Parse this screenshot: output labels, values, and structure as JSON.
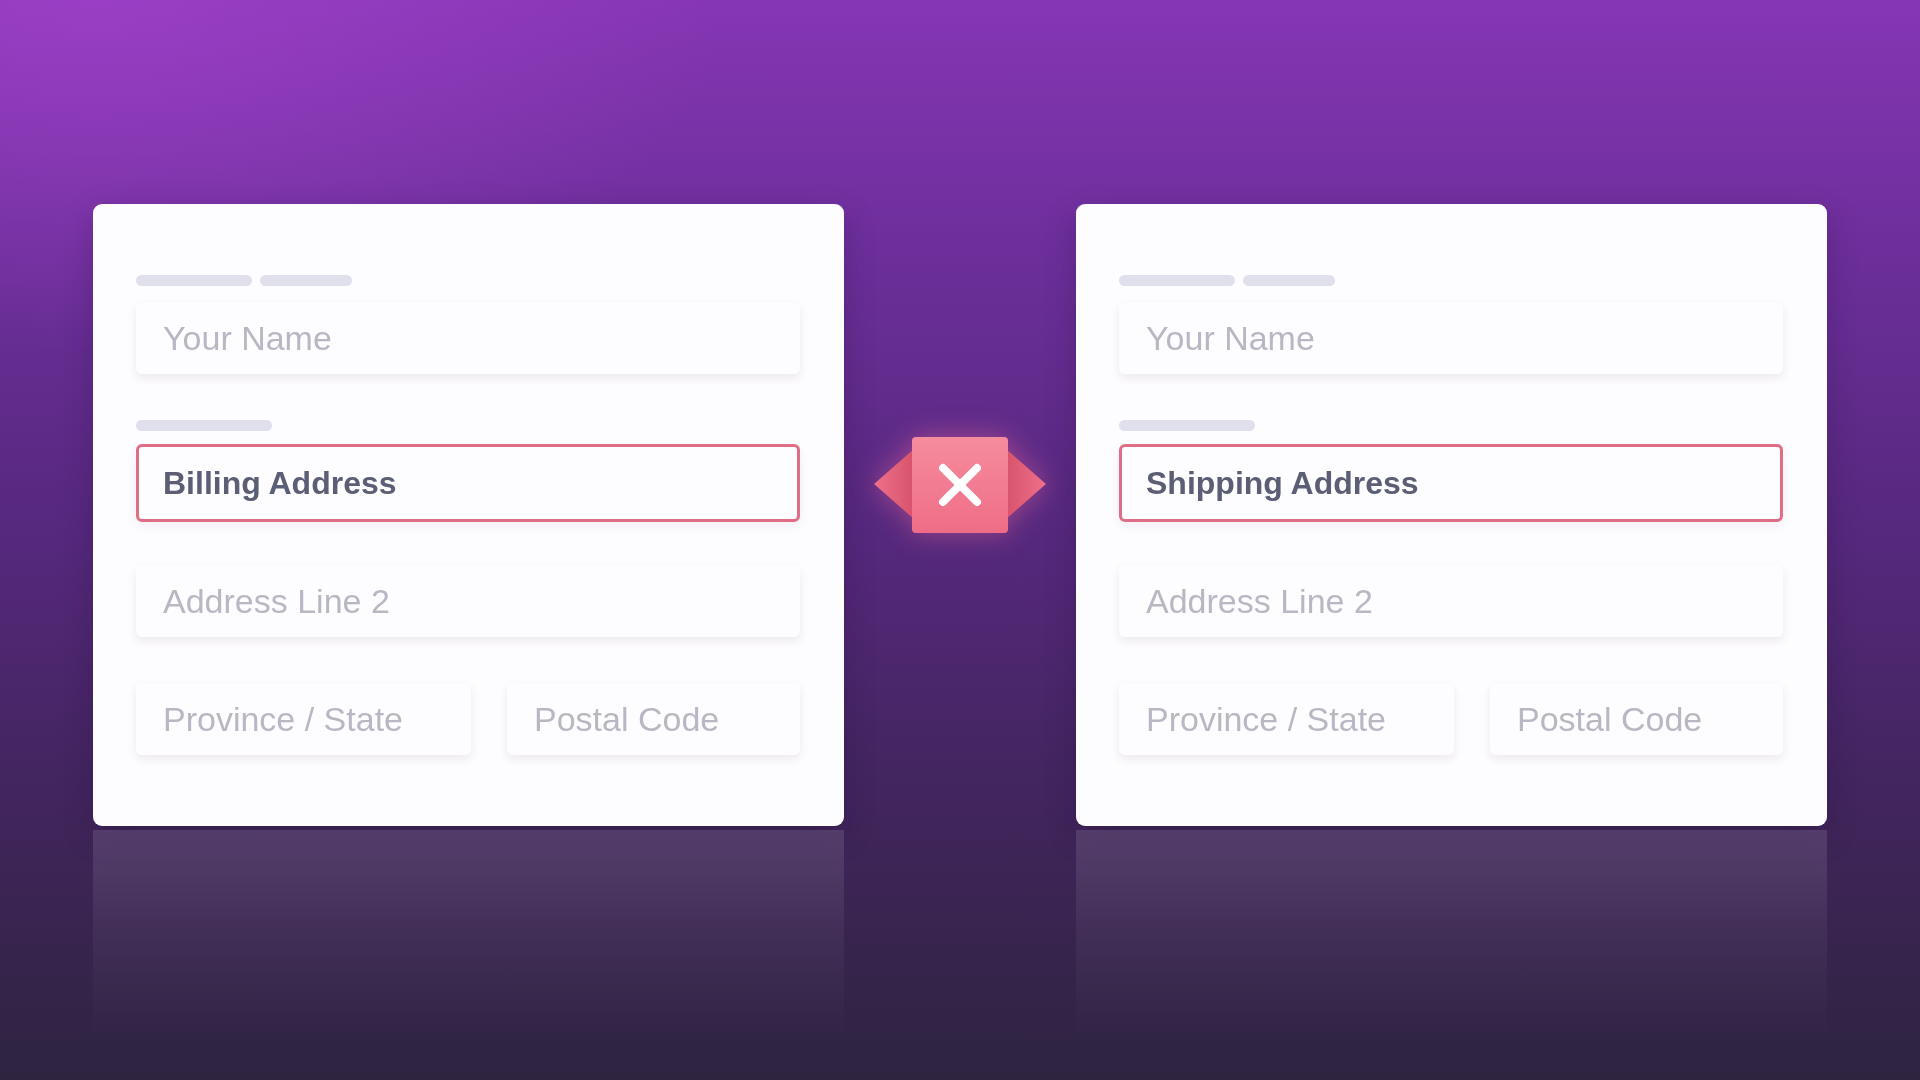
{
  "forms": [
    {
      "rows": [
        {
          "fields": [
            {
              "placeholder": "Your Name",
              "highlighted": false
            }
          ]
        },
        {
          "fields": [
            {
              "value": "Billing Address",
              "highlighted": true
            }
          ]
        },
        {
          "fields": [
            {
              "placeholder": "Address Line 2",
              "highlighted": false
            }
          ]
        },
        {
          "fields": [
            {
              "placeholder": "Province / State",
              "highlighted": false
            },
            {
              "placeholder": "Postal Code",
              "highlighted": false
            }
          ]
        }
      ]
    },
    {
      "rows": [
        {
          "fields": [
            {
              "placeholder": "Your Name",
              "highlighted": false
            }
          ]
        },
        {
          "fields": [
            {
              "value": "Shipping Address",
              "highlighted": true
            }
          ]
        },
        {
          "fields": [
            {
              "placeholder": "Address Line 2",
              "highlighted": false
            }
          ]
        },
        {
          "fields": [
            {
              "placeholder": "Province / State",
              "highlighted": false
            },
            {
              "placeholder": "Postal Code",
              "highlighted": false
            }
          ]
        }
      ]
    }
  ]
}
